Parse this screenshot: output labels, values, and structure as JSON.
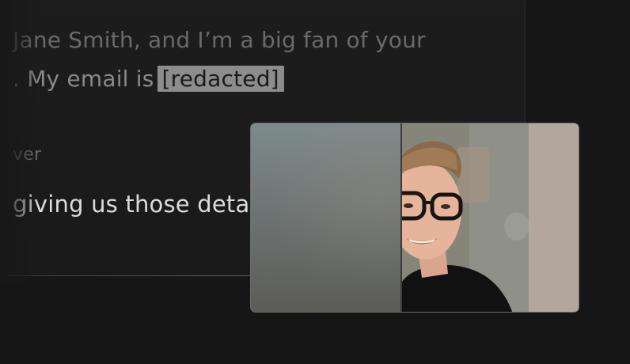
{
  "transcript": {
    "line_1": "Jane Smith, and I’m a big fan of your",
    "line_2_prefix": ". My email is",
    "line_2_redacted": "[redacted]",
    "speaker_label": "ver",
    "line_3": "giving us those deta"
  },
  "video": {
    "blur_left_half": true,
    "subject": "smiling person with glasses"
  },
  "colors": {
    "background": "#161616",
    "card": "#1c1c1c",
    "redacted_bg": "#8c8c8c",
    "text_primary": "#dcdcdc",
    "text_muted": "#6a6a6a"
  }
}
